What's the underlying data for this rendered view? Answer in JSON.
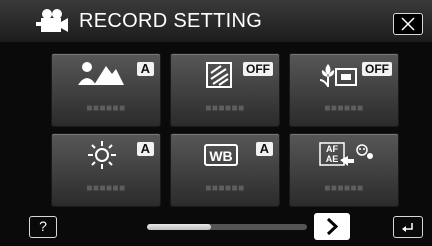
{
  "header": {
    "title": "RECORD SETTING",
    "icon": "video-camera-icon",
    "close_icon": "close-icon"
  },
  "tiles": [
    {
      "icon": "scene-select-icon",
      "badge": "A",
      "value_label": "■■■■■■"
    },
    {
      "icon": "light-icon",
      "badge": "OFF",
      "value_label": "■■■■■■"
    },
    {
      "icon": "tele-macro-icon",
      "badge": "OFF",
      "value_label": "■■■■■■"
    },
    {
      "icon": "brightness-icon",
      "badge": "A",
      "value_label": "■■■■■■"
    },
    {
      "icon": "white-balance-icon",
      "icon_text": "WB",
      "badge": "A",
      "value_label": "■■■■■■"
    },
    {
      "icon": "af-ae-face-icon",
      "icon_text_top": "AF",
      "icon_text_bottom": "AE",
      "value_label": "■■■■■■"
    }
  ],
  "footer": {
    "help_label": "?",
    "scroll_position": 0.4,
    "next_icon": "chevron-right-icon",
    "back_icon": "return-arrow-icon"
  },
  "colors": {
    "header_bg": "#2a2a2a",
    "tile_bg": "#4a4a4a",
    "badge_bg": "#f2f2f2",
    "background": "#0a0a0a"
  }
}
